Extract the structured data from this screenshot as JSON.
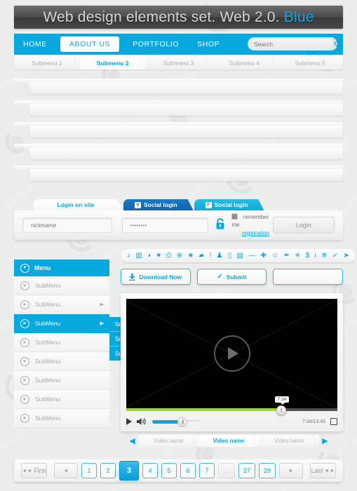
{
  "header": {
    "title_main": "Web design elements set. Web 2.0.",
    "title_accent": "Blue"
  },
  "nav": {
    "items": [
      {
        "label": "HOME",
        "active": false
      },
      {
        "label": "ABOUT US",
        "active": true
      },
      {
        "label": "PORTFOLIO",
        "active": false
      },
      {
        "label": "SHOP",
        "active": false
      }
    ],
    "search_placeholder": "Search",
    "search_value": "",
    "search_icon": "search-icon"
  },
  "submenu": {
    "tabs": [
      {
        "label": "Submenu 1",
        "active": false
      },
      {
        "label": "Submenu 2",
        "active": true
      },
      {
        "label": "Submenu 3",
        "active": false
      },
      {
        "label": "Submenu 4",
        "active": false
      },
      {
        "label": "Submenu 5",
        "active": false
      }
    ]
  },
  "strips": {
    "count": 5,
    "segments_per_strip": 5
  },
  "login": {
    "tabs": [
      {
        "label": "Login on site",
        "kind": "site",
        "badge": ""
      },
      {
        "label": "Social login",
        "kind": "vk",
        "badge": "V"
      },
      {
        "label": "Social login",
        "kind": "fb",
        "badge": "F"
      }
    ],
    "nickname_placeholder": "nickname",
    "nickname_value": "",
    "password_value": "••••••••",
    "lock_icon": "lock-icon",
    "remember_label": "remember me",
    "registration_label": "registration",
    "login_button": "Login"
  },
  "icon_toolbar": {
    "icons": [
      {
        "name": "music-note-icon",
        "glyph": "♪"
      },
      {
        "name": "bar-chart-icon",
        "glyph": "▥"
      },
      {
        "name": "tag-icon",
        "glyph": "◗"
      },
      {
        "name": "heart-icon",
        "glyph": "♥"
      },
      {
        "name": "printer-icon",
        "glyph": "⎙"
      },
      {
        "name": "globe-icon",
        "glyph": "⊕"
      },
      {
        "name": "star-icon",
        "glyph": "★"
      },
      {
        "name": "camera-icon",
        "glyph": "▰"
      },
      {
        "name": "exclamation-icon",
        "glyph": "!"
      },
      {
        "name": "user-icon",
        "glyph": "♟"
      },
      {
        "name": "trash-icon",
        "glyph": "▯"
      },
      {
        "name": "save-disk-icon",
        "glyph": "▤"
      },
      {
        "name": "minus-icon",
        "glyph": "—"
      },
      {
        "name": "plus-icon",
        "glyph": "✚"
      },
      {
        "name": "smiley-icon",
        "glyph": "☺"
      },
      {
        "name": "pin-icon",
        "glyph": "✒"
      },
      {
        "name": "asterisk-icon",
        "glyph": "✳"
      },
      {
        "name": "dollar-icon",
        "glyph": "$"
      },
      {
        "name": "info-icon",
        "glyph": "i"
      },
      {
        "name": "snowflake-icon",
        "glyph": "❄"
      },
      {
        "name": "check-icon",
        "glyph": "✓"
      },
      {
        "name": "play-arrow-icon",
        "glyph": "➤"
      }
    ]
  },
  "action_buttons": [
    {
      "label": "Download Now",
      "icon": "download-icon"
    },
    {
      "label": "Submit",
      "icon": "check-icon"
    },
    {
      "label": "",
      "icon": ""
    }
  ],
  "sidebar": {
    "header": {
      "label": "Menu",
      "icon": "chevron-down-circle-icon"
    },
    "items": [
      {
        "label": "SubMenu",
        "active": false,
        "has_arrow": false
      },
      {
        "label": "SubMenu",
        "active": false,
        "has_arrow": true
      },
      {
        "label": "SubMenu",
        "active": true,
        "has_arrow": true
      },
      {
        "label": "SubMenu",
        "active": false,
        "has_arrow": false
      },
      {
        "label": "SubMenu",
        "active": false,
        "has_arrow": false
      },
      {
        "label": "SubMenu",
        "active": false,
        "has_arrow": false
      },
      {
        "label": "SubMenu",
        "active": false,
        "has_arrow": false
      },
      {
        "label": "SubMenu",
        "active": false,
        "has_arrow": false
      }
    ],
    "flyout": [
      {
        "label": "SubMenu"
      },
      {
        "label": "SubMenu"
      },
      {
        "label": "SubMenu"
      }
    ]
  },
  "player": {
    "play_icon": "play-button-icon",
    "tooltip_time": "7:34",
    "time_display": "7:34/13.45",
    "progress_percent": 73,
    "volume_percent": 62,
    "mute_icon": "volume-icon",
    "fullscreen_icon": "fullscreen-icon",
    "progress_color": "#9bd236",
    "accent_color": "#0aa5dd"
  },
  "video_tabs": {
    "prev_icon": "chevron-left-icon",
    "next_icon": "chevron-right-icon",
    "tabs": [
      {
        "label": "Video name",
        "active": false
      },
      {
        "label": "Video name",
        "active": true
      },
      {
        "label": "Video name",
        "active": false
      }
    ]
  },
  "pagination": {
    "first_label": "First",
    "last_label": "Last",
    "prev_glyph": "◄",
    "next_glyph": "►",
    "first_glyph": "◄◄",
    "last_glyph": "►►",
    "dots": "...",
    "pages": [
      "1",
      "2",
      "3",
      "4",
      "5",
      "6",
      "7"
    ],
    "tail_pages": [
      "27",
      "28"
    ],
    "current": "3"
  },
  "theme": {
    "accent": "#06a8de",
    "accent_dark": "#0598cf",
    "bg": "#eceded",
    "title_bar": "#444648",
    "green": "#9bd236"
  }
}
